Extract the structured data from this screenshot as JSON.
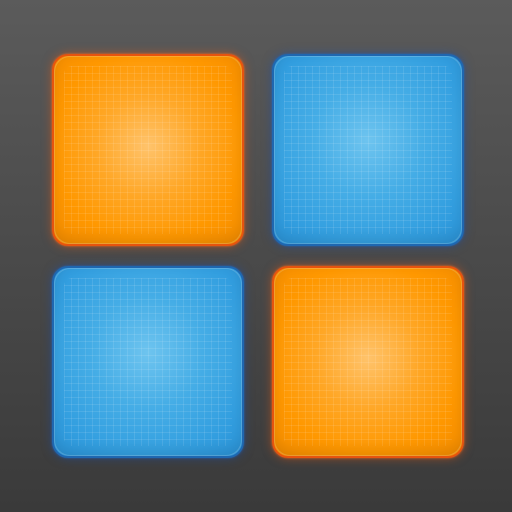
{
  "app": {
    "background_top": "#5b5b5b",
    "background_bottom": "#3a3a3a"
  },
  "pads": [
    {
      "position": "top-left",
      "color": "orange",
      "hex": "#ff9800"
    },
    {
      "position": "top-right",
      "color": "blue",
      "hex": "#339fe0"
    },
    {
      "position": "bottom-left",
      "color": "blue",
      "hex": "#339fe0"
    },
    {
      "position": "bottom-right",
      "color": "orange",
      "hex": "#ff9800"
    }
  ]
}
